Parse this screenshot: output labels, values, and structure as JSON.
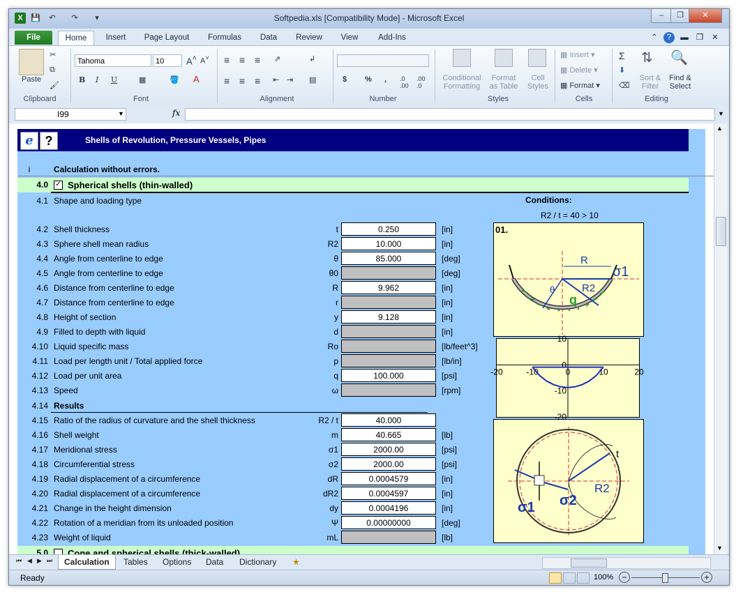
{
  "window": {
    "title": "Softpedia.xls  [Compatibility Mode]  -  Microsoft Excel",
    "controls": {
      "minimize": "–",
      "restore": "❐",
      "close": "✕"
    }
  },
  "ribbon": {
    "tabs": [
      "File",
      "Home",
      "Insert",
      "Page Layout",
      "Formulas",
      "Data",
      "Review",
      "View",
      "Add-Ins"
    ],
    "clipboard": {
      "paste": "Paste",
      "group": "Clipboard"
    },
    "font": {
      "name": "Tahoma",
      "size": "10",
      "group": "Font",
      "bold": "B",
      "italic": "I",
      "underline": "U"
    },
    "alignment": {
      "group": "Alignment"
    },
    "number": {
      "group": "Number",
      "currency": "$",
      "percent": "%",
      "comma": ","
    },
    "styles": {
      "conditional": "Conditional",
      "conditional2": "Formatting",
      "format_table": "Format",
      "format_table2": "as Table",
      "cell_styles": "Cell",
      "cell_styles2": "Styles",
      "group": "Styles"
    },
    "cells": {
      "insert": "Insert",
      "delete": "Delete",
      "format": "Format",
      "group": "Cells"
    },
    "editing": {
      "sum": "Σ",
      "sort": "Sort &",
      "sort2": "Filter",
      "find": "Find &",
      "find2": "Select",
      "group": "Editing"
    }
  },
  "formula_bar": {
    "name_box": "I99",
    "fx": "fx",
    "value": ""
  },
  "sheet": {
    "header_title": "Shells of Revolution, Pressure Vessels, Pipes",
    "help_icon": "?",
    "status_row": {
      "num": "i",
      "text": "Calculation without errors."
    },
    "section_4": {
      "num": "4.0",
      "check": "✓",
      "title": "Spherical shells (thin-walled)"
    },
    "row_41": {
      "num": "4.1",
      "label": "Shape and loading type"
    },
    "conditions_title": "Conditions:",
    "conditions_value": "R2 / t = 40 > 10",
    "rows": [
      {
        "num": "4.2",
        "label": "Shell thickness",
        "sym": "t",
        "val": "0.250",
        "unit": "[in]",
        "gray": false
      },
      {
        "num": "4.3",
        "label": "Sphere shell mean radius",
        "sym": "R2",
        "val": "10.000",
        "unit": "[in]",
        "gray": false
      },
      {
        "num": "4.4",
        "label": "Angle from centerline to edge",
        "sym": "θ",
        "val": "85.000",
        "unit": "[deg]",
        "gray": false
      },
      {
        "num": "4.5",
        "label": "Angle from centerline to edge",
        "sym": "θ0",
        "val": "",
        "unit": "[deg]",
        "gray": true
      },
      {
        "num": "4.6",
        "label": "Distance from centerline to edge",
        "sym": "R",
        "val": "9.962",
        "unit": "[in]",
        "gray": false
      },
      {
        "num": "4.7",
        "label": "Distance from centerline to edge",
        "sym": "r",
        "val": "",
        "unit": "[in]",
        "gray": true
      },
      {
        "num": "4.8",
        "label": "Height of section",
        "sym": "y",
        "val": "9.128",
        "unit": "[in]",
        "gray": false
      },
      {
        "num": "4.9",
        "label": "Filled to depth with liquid",
        "sym": "d",
        "val": "",
        "unit": "[in]",
        "gray": true
      },
      {
        "num": "4.10",
        "label": "Liquid specific mass",
        "sym": "Ro",
        "val": "",
        "unit": "[lb/feet^3]",
        "gray": true
      },
      {
        "num": "4.11",
        "label": "Load per length unit / Total applied force",
        "sym": "p",
        "val": "",
        "unit": "[lb/in]",
        "gray": true
      },
      {
        "num": "4.12",
        "label": "Load per unit area",
        "sym": "q",
        "val": "100.000",
        "unit": "[psi]",
        "gray": false
      },
      {
        "num": "4.13",
        "label": "Speed",
        "sym": "ω",
        "val": "",
        "unit": "[rpm]",
        "gray": true
      }
    ],
    "results_row": {
      "num": "4.14",
      "label": "Results"
    },
    "results": [
      {
        "num": "4.15",
        "label": "Ratio of the radius of curvature and the shell thickness",
        "sym": "R2 / t",
        "val": "40.000",
        "unit": "",
        "gray": false
      },
      {
        "num": "4.16",
        "label": "Shell weight",
        "sym": "m",
        "val": "40.665",
        "unit": "[lb]",
        "gray": false
      },
      {
        "num": "4.17",
        "label": "Meridional stress",
        "sym": "σ1",
        "val": "2000.00",
        "unit": "[psi]",
        "gray": false
      },
      {
        "num": "4.18",
        "label": "Circumferential stress",
        "sym": "σ2",
        "val": "2000.00",
        "unit": "[psi]",
        "gray": false
      },
      {
        "num": "4.19",
        "label": "Radial displacement of a circumference",
        "sym": "dR",
        "val": "0.0004579",
        "unit": "[in]",
        "gray": false
      },
      {
        "num": "4.20",
        "label": "Radial displacement of a circumference",
        "sym": "dR2",
        "val": "0.0004597",
        "unit": "[in]",
        "gray": false
      },
      {
        "num": "4.21",
        "label": "Change in the height dimension",
        "sym": "dy",
        "val": "0.0004196",
        "unit": "[in]",
        "gray": false
      },
      {
        "num": "4.22",
        "label": "Rotation of a meridian from its unloaded position",
        "sym": "Ψ",
        "val": "0.00000000",
        "unit": "[deg]",
        "gray": false
      },
      {
        "num": "4.23",
        "label": "Weight of liquid",
        "sym": "mL",
        "val": "",
        "unit": "[lb]",
        "gray": true
      }
    ],
    "section_5": {
      "num": "5.0",
      "title": "Cone and spherical shells (thick-walled)"
    },
    "fig1": {
      "label": "01.",
      "R": "R",
      "R2": "R2",
      "sigma": "σ1",
      "theta": "θ",
      "q": "q"
    },
    "fig2": {
      "t": "t",
      "R2": "R2",
      "sigma1": "σ1",
      "sigma2": "σ2"
    }
  },
  "chart_data": {
    "type": "line",
    "title": "",
    "xlim": [
      -20,
      20
    ],
    "ylim": [
      -20,
      10
    ],
    "x_ticks": [
      "-20",
      "-10",
      "0",
      "10",
      "20"
    ],
    "y_ticks": [
      "10",
      "0",
      "-10",
      "-20"
    ],
    "series": [
      {
        "x": [
          -9.962,
          -8,
          -6,
          -4,
          -2,
          0,
          2,
          4,
          6,
          8,
          9.962
        ],
        "y": [
          -0.872,
          -4.04,
          -6.2,
          -7.59,
          -8.43,
          -8.72,
          -8.43,
          -7.59,
          -6.2,
          -4.04,
          -0.872
        ]
      }
    ],
    "chord_y": 0
  },
  "sheet_tabs": {
    "nav": [
      "⏮",
      "◀",
      "▶",
      "⏭"
    ],
    "tabs": [
      "Calculation",
      "Tables",
      "Options",
      "Data",
      "Dictionary"
    ],
    "active": "Calculation"
  },
  "statusbar": {
    "ready": "Ready",
    "zoom": "100%",
    "minus": "−",
    "plus": "+"
  },
  "colors": {
    "header": "#000080",
    "sheet": "#99ccff",
    "section": "#ccffcc",
    "figure": "#ffffcc",
    "gray_cell": "#c0c0c0"
  }
}
